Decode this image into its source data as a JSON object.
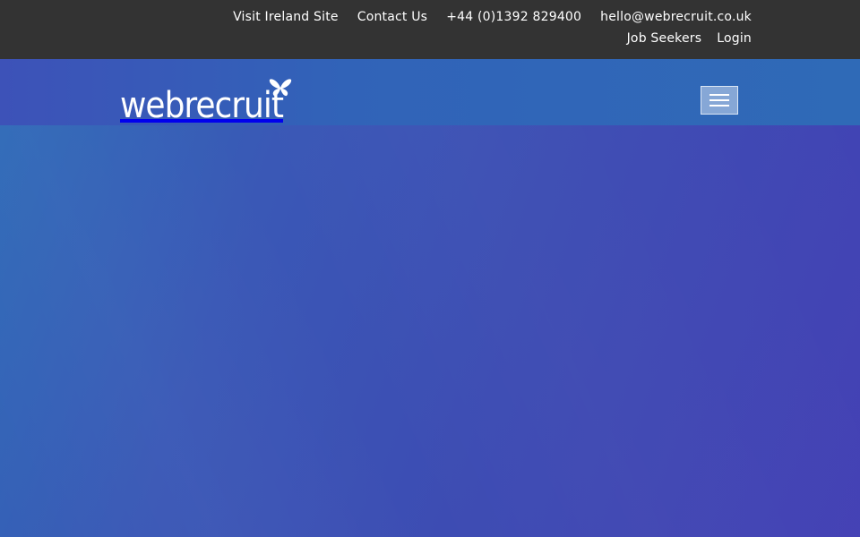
{
  "topbar": {
    "links": [
      {
        "label": "Visit Ireland Site"
      },
      {
        "label": "Contact Us"
      },
      {
        "label": "+44 (0)1392 829400"
      },
      {
        "label": "hello@webrecruit.co.uk"
      }
    ],
    "secondary_links": [
      {
        "label": "Job Seekers"
      },
      {
        "label": "Login"
      }
    ]
  },
  "header": {
    "logo_text": "webrecruit",
    "logo_icon": "butterfly-icon",
    "menu_icon": "hamburger-menu-icon"
  },
  "colors": {
    "topbar_bg": "#333333",
    "hero_start": "#2f6cb8",
    "hero_end": "#4340b4",
    "menu_button_bg": "#86a7d6"
  }
}
